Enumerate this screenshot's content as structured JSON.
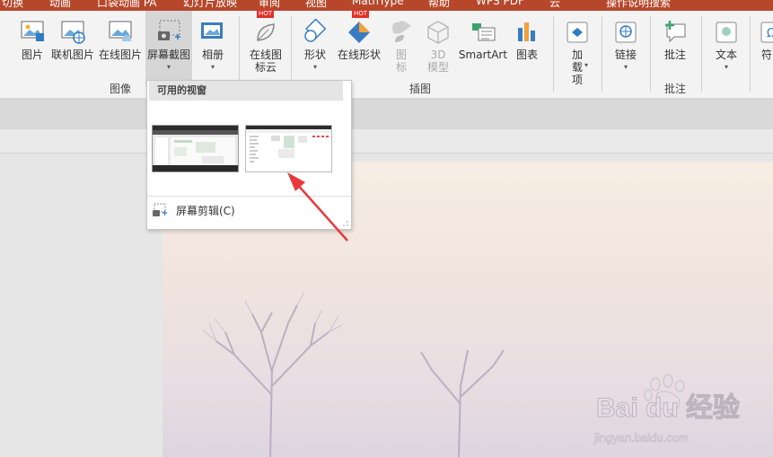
{
  "tabs": [
    "切换",
    "动画",
    "口袋动画 PA",
    "幻灯片放映",
    "审阅",
    "视图",
    "MathType",
    "帮助",
    "WPS PDF",
    "云",
    "操作说明搜索"
  ],
  "ribbon": {
    "image_group": {
      "label": "图像",
      "picture": "图片",
      "online_picture": "联机图片",
      "online_image": "在线图片",
      "screenshot": "屏幕截图",
      "album": "相册"
    },
    "online_icons": "在线图标云",
    "illustration_group": {
      "label": "插图",
      "shapes": "形状",
      "online_shapes": "在线形状",
      "icons": "图标",
      "model3d": "3D 模型",
      "smartart": "SmartArt",
      "chart": "图表"
    },
    "addins": "加载项",
    "link": "链接",
    "comment_group": {
      "label": "批注",
      "comment": "批注"
    },
    "text": "文本",
    "symbol": "符",
    "hot_badge": "HOT"
  },
  "popup": {
    "header": "可用的视窗",
    "screen_clipping": "屏幕剪辑(C)"
  },
  "watermark": {
    "brand": "Bai du 经验",
    "url": "jingyan.baidu.com"
  },
  "colors": {
    "accent": "#b7472a",
    "arrow": "#e8393b",
    "hot": "#e0312a"
  }
}
